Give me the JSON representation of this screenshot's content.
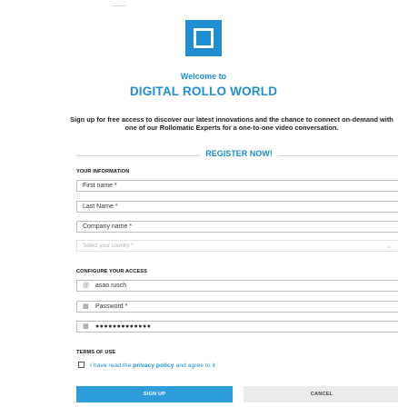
{
  "header": {
    "welcome": "Welcome to",
    "brand": "DIGITAL ROLLO WORLD",
    "intro": "Sign up for free access to discover our latest innovations and the chance to connect on-demand with one of our Rollomatic Experts for a one-to-one video conversation."
  },
  "register_label": "REGISTER NOW!",
  "your_information": {
    "title": "YOUR INFORMATION",
    "first_name_placeholder": "First name *",
    "last_name_placeholder": "Last Name *",
    "company_placeholder": "Company name *",
    "country_placeholder": "Select your country *"
  },
  "access": {
    "title": "CONFIGURE YOUR ACCESS",
    "username_value": "asao.rusch",
    "password_placeholder": "Password *",
    "password_confirm_value": "●●●●●●●●●●●●●"
  },
  "terms": {
    "title": "TERMS OF USE",
    "prefix": "I have read the ",
    "link": "privacy policy",
    "suffix": " and agree to it."
  },
  "buttons": {
    "signup": "SIGN UP",
    "cancel": "CANCEL"
  },
  "colors": {
    "accent": "#1f8ed0",
    "button_primary": "#2e9ddb",
    "button_secondary": "#ebebeb"
  },
  "icons": {
    "username": "at-sign-icon",
    "password": "lock-icon",
    "country": "chevron-down-icon"
  }
}
